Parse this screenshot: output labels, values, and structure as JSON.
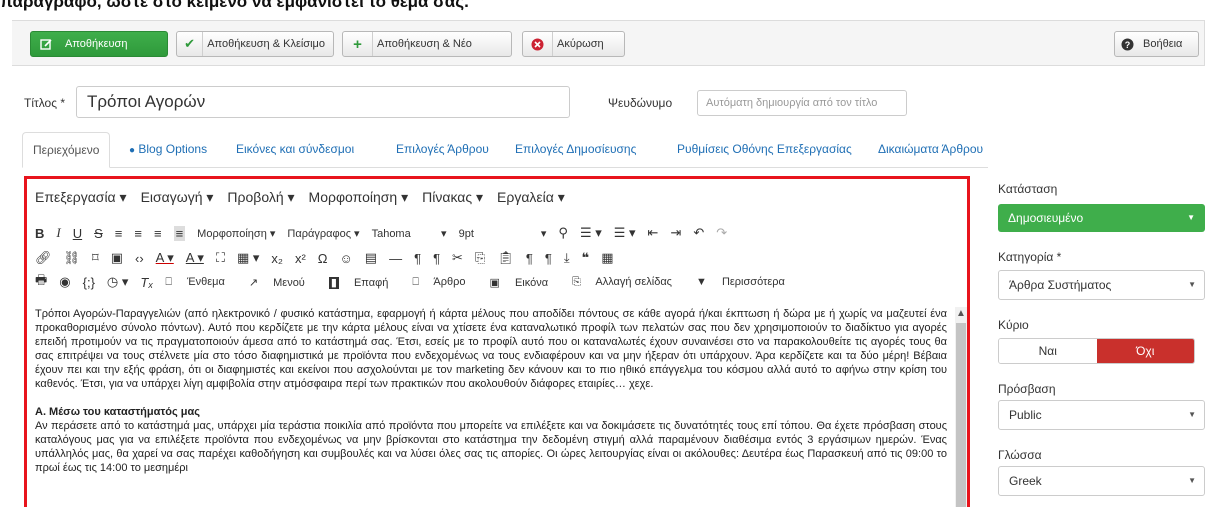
{
  "caption": "παράγραφο, ώστε στο κείμενο να εμφανιστεί το θέμα σας.",
  "toolbar": {
    "save": "Αποθήκευση",
    "save_close": "Αποθήκευση & Κλείσιμο",
    "save_new": "Αποθήκευση & Νέο",
    "cancel": "Ακύρωση",
    "help": "Βοήθεια"
  },
  "title": {
    "label": "Τίτλος *",
    "value": "Τρόποι Αγορών"
  },
  "alias": {
    "label": "Ψευδώνυμο",
    "placeholder": "Αυτόματη δημιουργία από τον τίτλο"
  },
  "tabs": [
    "Περιεχόμενο",
    "Blog Options",
    "Εικόνες και σύνδεσμοι",
    "Επιλογές Άρθρου",
    "Επιλογές Δημοσίευσης",
    "Ρυθμίσεις Οθόνης Επεξεργασίας",
    "Δικαιώματα Άρθρου"
  ],
  "editor": {
    "menus": [
      "Επεξεργασία ▾",
      "Εισαγωγή ▾",
      "Προβολή ▾",
      "Μορφοποίηση ▾",
      "Πίνακας ▾",
      "Εργαλεία ▾"
    ],
    "format_dropdown": "Μορφοποίηση ▾",
    "paragraph_dropdown": "Παράγραφος ▾",
    "font_dropdown": "Tahoma",
    "size_dropdown": "9pt",
    "buttons_row3": [
      "Ένθεμα",
      "Μενού",
      "Επαφή",
      "Άρθρο",
      "Εικόνα",
      "Αλλαγή σελίδας",
      "Περισσότερα"
    ],
    "paragraph1": "Τρόποι Αγορών-Παραγγελιών (από ηλεκτρονικό / φυσικό κατάστημα, εφαρμογή ή κάρτα μέλους που αποδίδει πόντους σε κάθε αγορά ή/και έκπτωση ή δώρα με ή χωρίς να μαζευτεί ένα προκαθορισμένο σύνολο πόντων). Αυτό που κερδίζετε με την κάρτα μέλους είναι να χτίσετε ένα καταναλωτικό προφίλ των πελατών σας που δεν χρησιμοποιούν το διαδίκτυο για αγορές επειδή προτιμούν να τις πραγματοποιούν άμεσα από το κατάστημά σας. Έτσι, εσείς με το προφίλ αυτό που οι καταναλωτές έχουν συναινέσει στο να παρακολουθείτε τις αγορές τους θα σας επιτρέψει να τους στέλνετε μία στο τόσο διαφημιστικά με προϊόντα που ενδεχομένως να τους ενδιαφέρουν και να μην ήξεραν ότι υπάρχουν. Άρα κερδίζετε και τα δύο μέρη! Βέβαια έχουν πει και την εξής φράση, ότι οι διαφημιστές και εκείνοι που ασχολούνται με τον marketing δεν κάνουν και το πιο ηθικό επάγγελμα του κόσμου αλλά αυτό το αφήνω στην κρίση του καθενός. Έτσι, για να υπάρχει λίγη αμφιβολία στην ατμόσφαιρα περί των πρακτικών που ακολουθούν διάφορες εταιρίες… χεχε.",
    "heading_a": "Α. Μέσω του καταστήματός μας",
    "paragraph2": "Αν περάσετε από το κατάστημά μας, υπάρχει μία τεράστια ποικιλία από προϊόντα που μπορείτε να επιλέξετε και να δοκιμάσετε τις δυνατότητές τους επί τόπου. Θα έχετε πρόσβαση στους καταλόγους μας για να επιλέξετε προϊόντα που ενδεχομένως να μην βρίσκονται στο κατάστημα την δεδομένη στιγμή αλλά παραμένουν διαθέσιμα εντός 3 εργάσιμων ημερών. Ένας υπάλληλός μας, θα χαρεί να σας παρέχει καθοδήγηση και συμβουλές και να λύσει όλες σας τις απορίες. Οι ώρες λειτουργίας είναι οι ακόλουθες: Δευτέρα έως Παρασκευή  από τις 09:00 το πρωί έως τις 14:00 το μεσημέρι"
  },
  "sidebar": {
    "status_label": "Κατάσταση",
    "status_value": "Δημοσιευμένο",
    "category_label": "Κατηγορία *",
    "category_value": "Άρθρα Συστήματος",
    "featured_label": "Κύριο",
    "featured_yes": "Ναι",
    "featured_no": "Όχι",
    "access_label": "Πρόσβαση",
    "access_value": "Public",
    "language_label": "Γλώσσα",
    "language_value": "Greek"
  },
  "colors": {
    "save_green": "#3fae4b",
    "active_red": "#c9302c",
    "link_blue": "#1f6fb5",
    "highlight_border": "#e8141c"
  }
}
